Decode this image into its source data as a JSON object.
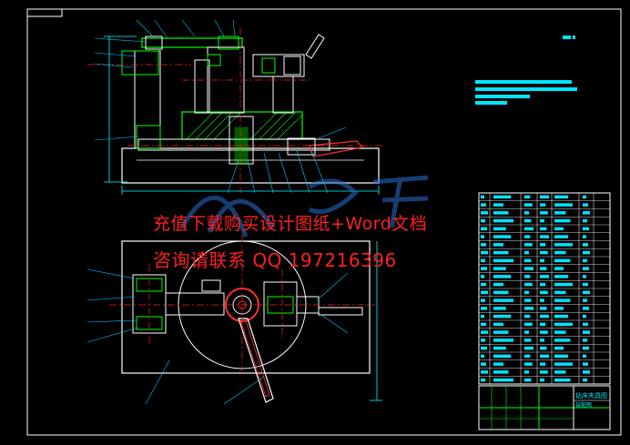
{
  "drawing": {
    "title_block_cn": "钻床夹具图",
    "title_block_sub": "装配图",
    "colors": {
      "background": "#000000",
      "outline": "#ffffff",
      "centerline": "#ff2020",
      "dimension": "#00ffff",
      "part": "#00ff00",
      "hatch": "#00ff00",
      "leader": "#00c8ff",
      "handle": "#ff3030",
      "watermark": "#ff2020",
      "text_blocks": "#00e5ff"
    }
  },
  "watermark": {
    "line1": "充值下载购买设计图纸+Word文档",
    "line2": "咨询请联系  QQ 197216396",
    "logo": "人人文库"
  }
}
